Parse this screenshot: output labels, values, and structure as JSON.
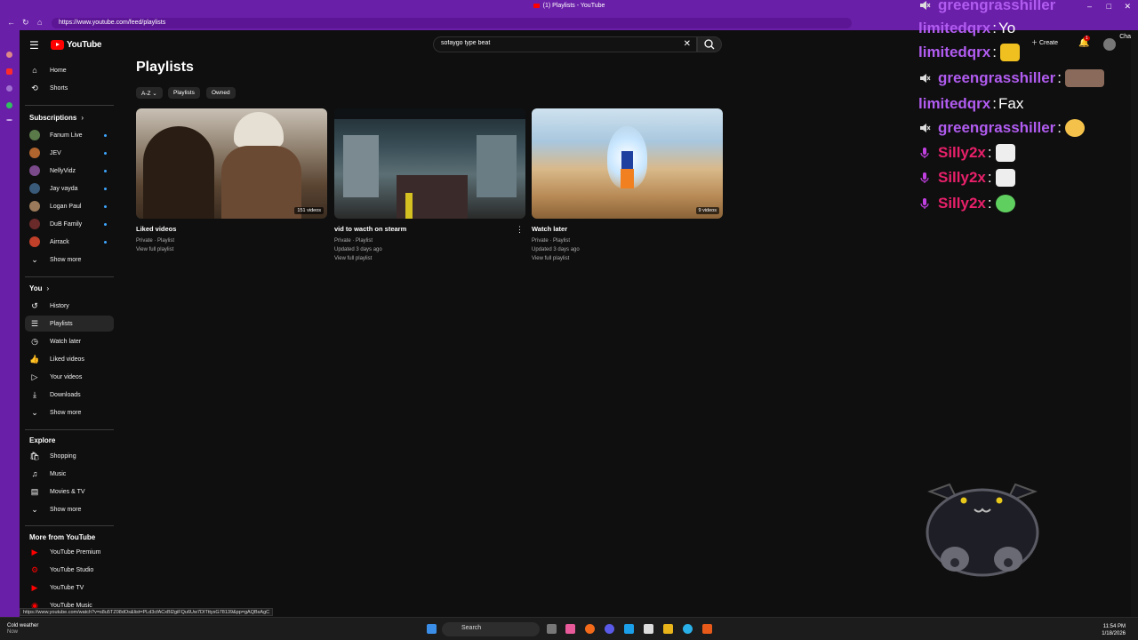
{
  "browser": {
    "title": "(1) Playlists - YouTube",
    "url": "https://www.youtube.com/feed/playlists",
    "chat_label": "Chat"
  },
  "header": {
    "logo_text": "YouTube",
    "search_value": "sofaygo type beat",
    "create_label": "Create",
    "notification_count": "1"
  },
  "sidebar": {
    "main": [
      {
        "label": "Home",
        "icon": "home-icon"
      },
      {
        "label": "Shorts",
        "icon": "shorts-icon"
      }
    ],
    "subscriptions_title": "Subscriptions",
    "subscriptions": [
      {
        "label": "Fanum Live",
        "color": "#5a7a4a"
      },
      {
        "label": "JEV",
        "color": "#b0642e"
      },
      {
        "label": "NellyVidz",
        "color": "#7a4a8a"
      },
      {
        "label": "Jay vayda",
        "color": "#3a5a7a"
      },
      {
        "label": "Logan Paul",
        "color": "#9a7a5a"
      },
      {
        "label": "DuB Family",
        "color": "#6a2a2a"
      },
      {
        "label": "Airrack",
        "color": "#c0402a"
      }
    ],
    "subs_show_more": "Show more",
    "you_title": "You",
    "you": [
      {
        "label": "History",
        "icon": "history-icon"
      },
      {
        "label": "Playlists",
        "icon": "playlists-icon"
      },
      {
        "label": "Watch later",
        "icon": "watch-later-icon"
      },
      {
        "label": "Liked videos",
        "icon": "liked-icon"
      },
      {
        "label": "Your videos",
        "icon": "your-videos-icon"
      },
      {
        "label": "Downloads",
        "icon": "downloads-icon"
      }
    ],
    "you_show_more": "Show more",
    "explore_title": "Explore",
    "explore": [
      {
        "label": "Shopping",
        "icon": "shopping-icon"
      },
      {
        "label": "Music",
        "icon": "music-icon"
      },
      {
        "label": "Movies & TV",
        "icon": "movies-icon"
      }
    ],
    "explore_show_more": "Show more",
    "more_title": "More from YouTube",
    "more": [
      {
        "label": "YouTube Premium"
      },
      {
        "label": "YouTube Studio"
      },
      {
        "label": "YouTube TV"
      },
      {
        "label": "YouTube Music"
      }
    ]
  },
  "main": {
    "title": "Playlists",
    "chips": [
      "A-Z",
      "Playlists",
      "Owned"
    ],
    "playlists": [
      {
        "title": "Liked videos",
        "meta1": "Private · Playlist",
        "meta2": "",
        "link": "View full playlist",
        "count": "151 videos"
      },
      {
        "title": "vid to wacth on stearm",
        "meta1": "Private · Playlist",
        "meta2": "Updated 3 days ago",
        "link": "View full playlist",
        "count": ""
      },
      {
        "title": "Watch later",
        "meta1": "Private · Playlist",
        "meta2": "Updated 3 days ago",
        "link": "View full playlist",
        "count": "9 videos"
      }
    ]
  },
  "chat": [
    {
      "user": "greengrasshiller",
      "color": "#b15cf0",
      "text": "",
      "badge": "speaker"
    },
    {
      "user": "limitedqrx",
      "color": "#b15cf0",
      "text": "Yo",
      "badge": ""
    },
    {
      "user": "limitedqrx",
      "color": "#b15cf0",
      "text": "",
      "badge": ""
    },
    {
      "user": "greengrasshiller",
      "color": "#b15cf0",
      "text": "",
      "badge": "speaker"
    },
    {
      "user": "limitedqrx",
      "color": "#b15cf0",
      "text": "Fax",
      "badge": ""
    },
    {
      "user": "greengrasshiller",
      "color": "#b15cf0",
      "text": "",
      "badge": "speaker"
    },
    {
      "user": "Silly2x",
      "color": "#e8206a",
      "text": "",
      "badge": "mic"
    },
    {
      "user": "Silly2x",
      "color": "#e8206a",
      "text": "",
      "badge": "mic"
    },
    {
      "user": "Silly2x",
      "color": "#e8206a",
      "text": "",
      "badge": "mic"
    }
  ],
  "status_url": "https://www.youtube.com/watch?v=s8u5TZ08dOs&list=PLd3cfACxBl2giFQu6Uw7DITttysG78139&pp=gAQBsAgC",
  "taskbar": {
    "weather_line1": "Cold weather",
    "weather_line2": "Now",
    "search_label": "Search",
    "time": "11:54 PM",
    "date": "1/18/2026"
  }
}
